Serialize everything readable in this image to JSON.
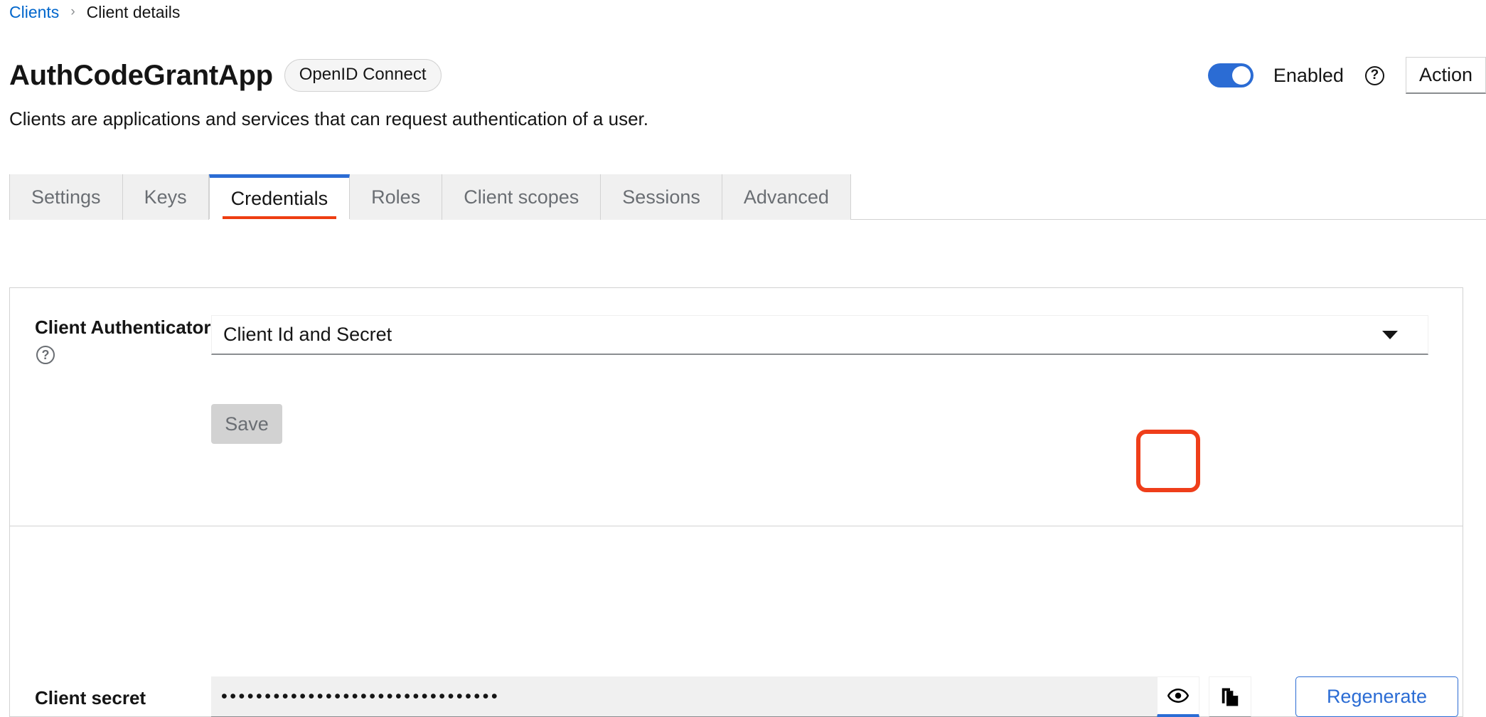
{
  "breadcrumb": {
    "parent": "Clients",
    "separator": "›",
    "current": "Client details"
  },
  "header": {
    "title": "AuthCodeGrantApp",
    "protocol_badge": "OpenID Connect",
    "subtitle": "Clients are applications and services that can request authentication of a user.",
    "enabled_label": "Enabled",
    "enabled_state": "on",
    "help_icon_glyph": "?",
    "action_button": "Action",
    "accent_color": "#2b6cd4"
  },
  "tabs": {
    "items": [
      {
        "label": "Settings",
        "active": false
      },
      {
        "label": "Keys",
        "active": false
      },
      {
        "label": "Credentials",
        "active": true
      },
      {
        "label": "Roles",
        "active": false
      },
      {
        "label": "Client scopes",
        "active": false
      },
      {
        "label": "Sessions",
        "active": false
      },
      {
        "label": "Advanced",
        "active": false
      }
    ],
    "active_top_color": "#2b6cd4",
    "active_underline_color": "#ee3d11"
  },
  "credentials": {
    "authenticator": {
      "label": "Client Authenticator",
      "help_glyph": "?",
      "selected_value": "Client Id and Secret",
      "caret_icon": "chevron-down-icon"
    },
    "save_label": "Save",
    "save_disabled": true,
    "secret": {
      "label": "Client secret",
      "masked_value": "••••••••••••••••••••••••••••••••",
      "show_icon": "eye-icon",
      "copy_icon": "copy-icon",
      "regenerate_label": "Regenerate",
      "regenerate_color": "#2b6cd4"
    }
  },
  "annotation": {
    "target": "show-secret-eye-button",
    "color": "#ef3e1a"
  }
}
